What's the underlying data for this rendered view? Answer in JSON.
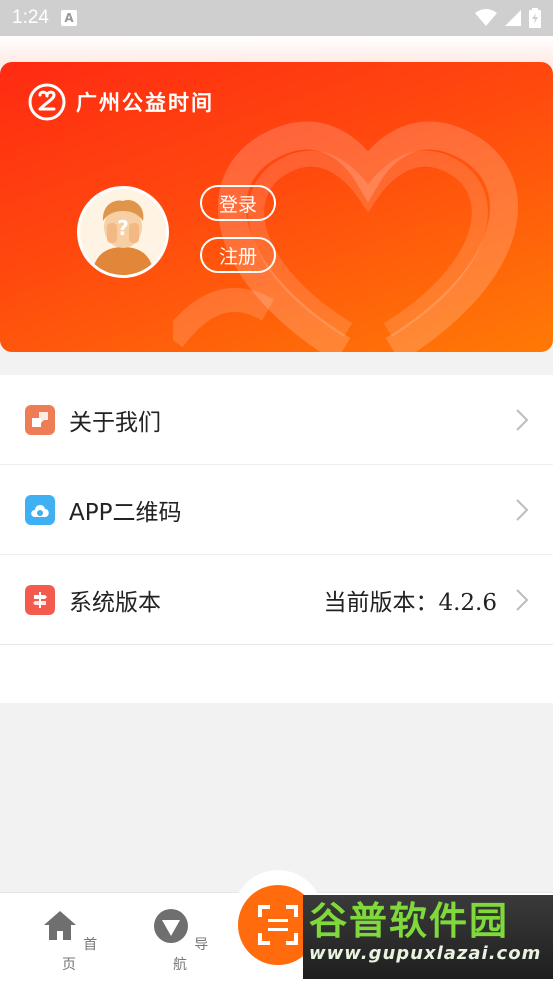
{
  "status_bar": {
    "time": "1:24",
    "notification_letter": "A"
  },
  "header": {
    "brand_name": "广州公益时间",
    "login_label": "登录",
    "register_label": "注册"
  },
  "menu": {
    "items": [
      {
        "label": "关于我们",
        "icon": "about-icon",
        "icon_color": "#ee7d55"
      },
      {
        "label": "APP二维码",
        "icon": "cloud-icon",
        "icon_color": "#3fb0f2"
      },
      {
        "label": "系统版本",
        "icon": "signpost-icon",
        "icon_color": "#f25b4d",
        "value": "当前版本：4.2.6"
      }
    ]
  },
  "bottom_nav": {
    "items": [
      {
        "label": "首页",
        "icon": "home-icon"
      },
      {
        "label": "导航",
        "icon": "navigation-icon"
      }
    ],
    "scan_icon": "scan-icon"
  },
  "watermark": {
    "title": "谷普软件园",
    "url": "www.gupuxlazai.com"
  },
  "colors": {
    "brand_red": "#ff2a12",
    "brand_orange": "#ff7a06",
    "scan_orange": "#ff6b0d"
  }
}
